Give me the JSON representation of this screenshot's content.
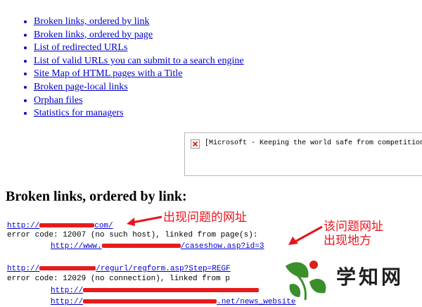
{
  "nav": {
    "items": [
      {
        "label": "Broken links, ordered by link"
      },
      {
        "label": "Broken links, ordered by page"
      },
      {
        "label": "List of redirected URLs"
      },
      {
        "label": "List of valid URLs you can submit to a search engine"
      },
      {
        "label": "Site Map of HTML pages with a Title"
      },
      {
        "label": "Broken page-local links"
      },
      {
        "label": "Orphan files"
      },
      {
        "label": "Statistics for managers"
      }
    ]
  },
  "ad": {
    "icon": "broken-image-icon",
    "alt_text": "[Microsoft - Keeping the world safe from competition!"
  },
  "heading": "Broken links, ordered by link:",
  "errors": [
    {
      "url_prefix": "http://",
      "url_suffix": "com/",
      "error_line": "error code: 12007 (no such host), linked from page(s):",
      "referrer_prefix": "http://www.",
      "referrer_suffix": "/caseshow.asp?id=",
      "referrer_tail": "3"
    },
    {
      "url_prefix": "http://",
      "url_suffix": "/regurl/regform.asp?Step=REGF",
      "error_line": "error code: 12029 (no connection), linked from p",
      "referrer_prefix": "http://",
      "referrer_suffix": "",
      "referrer_tail": "",
      "extra_line_prefix": "http://",
      "extra_line_middle": ".net/news_website"
    }
  ],
  "annotations": {
    "problem_url": "出现问题的网址",
    "problem_page_line1": "该问题网址",
    "problem_page_line2": "出现地方"
  },
  "watermark": {
    "text": "学知网",
    "icon": "leaf-logo-icon",
    "colors": {
      "green": "#3a8f2a",
      "red": "#d8221a"
    }
  },
  "colors": {
    "link": "#0000cc",
    "annotation": "#e8141c"
  }
}
